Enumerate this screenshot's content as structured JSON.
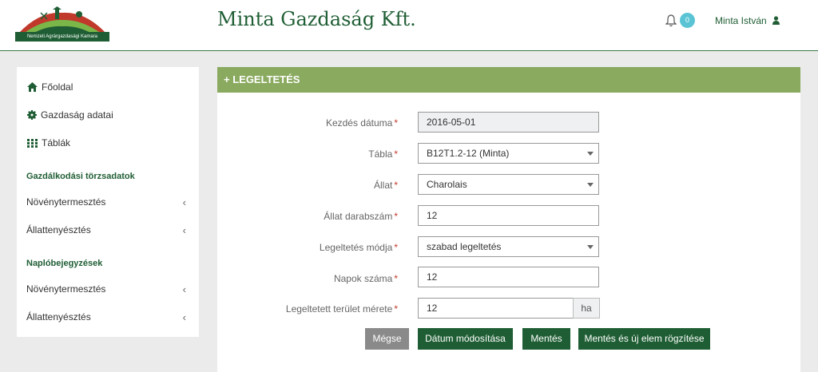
{
  "header": {
    "logo_text": "Nemzeti Agrárgazdasági Kamara",
    "company": "Minta Gazdaság Kft.",
    "notification_count": "0",
    "user_name": "Minta István",
    "bell_icon": "bell-icon",
    "user_icon": "user-icon"
  },
  "sidebar": {
    "home": "Főoldal",
    "farm_data": "Gazdaság adatai",
    "tables": "Táblák",
    "section1": "Gazdálkodási törzsadatok",
    "crop1": "Növénytermesztés",
    "animal1": "Állattenyésztés",
    "section2": "Naplóbejegyzések",
    "crop2": "Növénytermesztés",
    "animal2": "Állattenyésztés"
  },
  "panel": {
    "title": "+ LEGELTETÉS",
    "fields": {
      "start_date": {
        "label": "Kezdés dátuma",
        "value": "2016-05-01"
      },
      "table": {
        "label": "Tábla",
        "value": "B12T1.2-12 (Minta)"
      },
      "animal": {
        "label": "Állat",
        "value": "Charolais"
      },
      "count": {
        "label": "Állat darabszám",
        "value": "12"
      },
      "mode": {
        "label": "Legeltetés módja",
        "value": "szabad legeltetés"
      },
      "days": {
        "label": "Napok száma",
        "value": "12"
      },
      "area": {
        "label": "Legeltetett terület mérete",
        "value": "12",
        "unit": "ha"
      }
    },
    "required_mark": "*",
    "buttons": {
      "cancel": "Mégse",
      "change_date": "Dátum módosítása",
      "save": "Mentés",
      "save_new": "Mentés és új elem rögzítése"
    }
  },
  "colors": {
    "brand_green": "#1f5e34",
    "panel_header": "#8aaa5f",
    "badge": "#5ac4d4"
  }
}
